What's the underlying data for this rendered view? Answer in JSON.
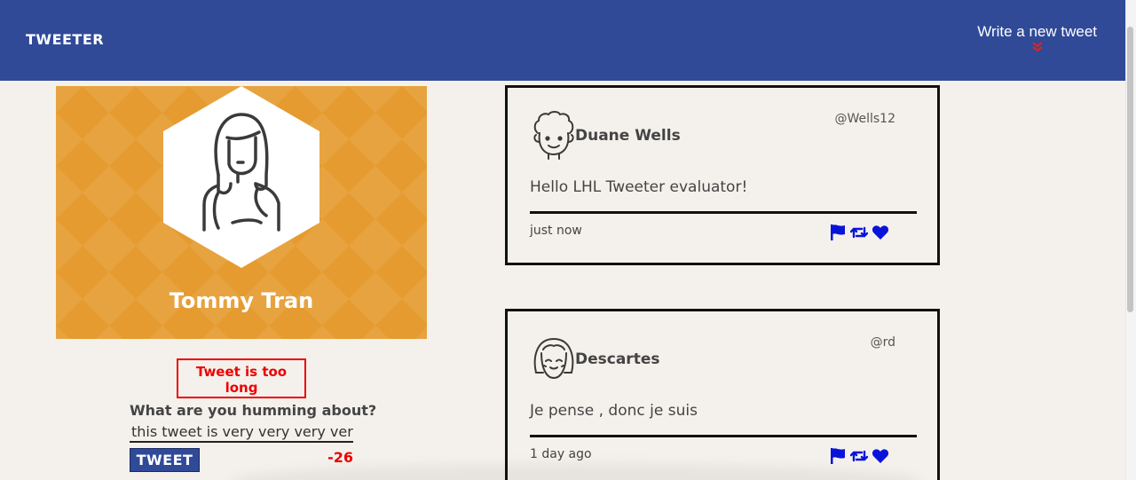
{
  "nav": {
    "logo": "TWEETER",
    "compose_label": "Write a new tweet",
    "background": "#304a98",
    "chevron_color": "#e02020"
  },
  "profile": {
    "name": "Tommy Tran",
    "background": "#e59b30"
  },
  "composer": {
    "error_message": "Tweet is too long",
    "prompt": "What are you humming about?",
    "input_value": "this tweet is very very very very very",
    "submit_label": "TWEET",
    "counter": "-26",
    "counter_color": "#e00000"
  },
  "tweets": [
    {
      "author": "Duane Wells",
      "handle": "@Wells12",
      "content": "Hello LHL Tweeter evaluator!",
      "timestamp": "just now",
      "avatar_icon": "curly-hair-avatar-icon"
    },
    {
      "author": "Descartes",
      "handle": "@rd",
      "content": "Je pense , donc je suis",
      "timestamp": "1 day ago",
      "avatar_icon": "bob-hair-avatar-icon"
    }
  ],
  "action_icons": [
    "flag-icon",
    "retweet-icon",
    "heart-icon"
  ],
  "action_icon_color": "#0a14d9"
}
